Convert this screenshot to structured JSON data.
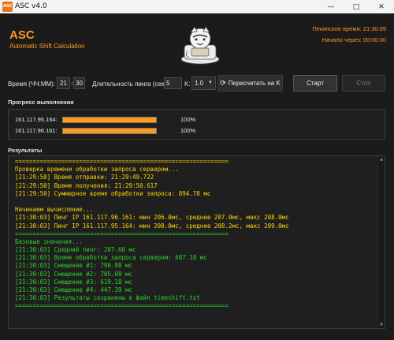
{
  "window": {
    "title": "ASC v4.0",
    "icon_text": "ASC"
  },
  "header": {
    "brand": "ASC",
    "subtitle": "Automatic Shift Calculation",
    "beijing_time": "Пекинское время: 21:30:09",
    "start_in": "Начало через: 00:00:00"
  },
  "controls": {
    "time_label": "Время (ЧЧ:ММ):",
    "hour": "21",
    "minute": "30",
    "ping_duration_label": "Длительность пинга (сек):",
    "ping_duration": "5",
    "k_label": "K:",
    "k_value": "1.0",
    "recalc_label": "Пересчитать на K",
    "start_label": "Старт",
    "stop_label": "Стоп"
  },
  "progress": {
    "heading": "Прогресс выполнения",
    "rows": [
      {
        "label": "161.117.95.164:",
        "value": 1.0,
        "pct": "100%"
      },
      {
        "label": "161.117.96.161:",
        "value": 1.0,
        "pct": "100%"
      }
    ]
  },
  "results": {
    "heading": "Результаты",
    "lines": [
      {
        "text": "============================================================",
        "color": "#ffd400"
      },
      {
        "text": "Проверка времени обработки запроса сервером...",
        "color": "#ffd400"
      },
      {
        "text": "[21:29:50] Время отправки: 21:29:49.722",
        "color": "#ffd400"
      },
      {
        "text": "[21:29:50] Время получения: 21:29:50.617",
        "color": "#ffd400"
      },
      {
        "text": "[21:29:50] Суммарное время обработки запроса: 894.78 мс",
        "color": "#ffd400"
      },
      {
        "text": "",
        "color": "#ffd400"
      },
      {
        "text": "Начинаем вычисление...",
        "color": "#ffd400"
      },
      {
        "text": "[21:30:03] Пинг IP 161.117.96.161: мин 206.0мс, среднее 207.0мс, макс 208.0мс",
        "color": "#ffd400"
      },
      {
        "text": "[21:30:03] Пинг IP 161.117.95.164: мин 208.0мс, среднее 208.2мс, макс 209.0мс",
        "color": "#ffd400"
      },
      {
        "text": "============================================================",
        "color": "#2bd62b"
      },
      {
        "text": "Базовые значения...",
        "color": "#2bd62b"
      },
      {
        "text": "[21:30:03] Средний пинг: 207.60 мс",
        "color": "#2bd62b"
      },
      {
        "text": "[21:30:03] Время обработки запроса сервером: 687.18 мс",
        "color": "#2bd62b"
      },
      {
        "text": "[21:30:03] Смещение #1: 790.98 мс",
        "color": "#2bd62b"
      },
      {
        "text": "[21:30:03] Смещение #2: 705.08 мс",
        "color": "#2bd62b"
      },
      {
        "text": "[21:30:03] Смещение #3: 619.18 мс",
        "color": "#2bd62b"
      },
      {
        "text": "[21:30:03] Смещение #4: 447.39 мс",
        "color": "#2bd62b"
      },
      {
        "text": "[21:30:03] Результаты сохранены в файл timeshift.txt",
        "color": "#2bd62b"
      },
      {
        "text": "============================================================",
        "color": "#2bd62b"
      }
    ]
  },
  "colors": {
    "accent": "#ff9a1f",
    "log_yellow": "#ffd400",
    "log_green": "#2bd62b",
    "background": "#1b1b1b"
  }
}
